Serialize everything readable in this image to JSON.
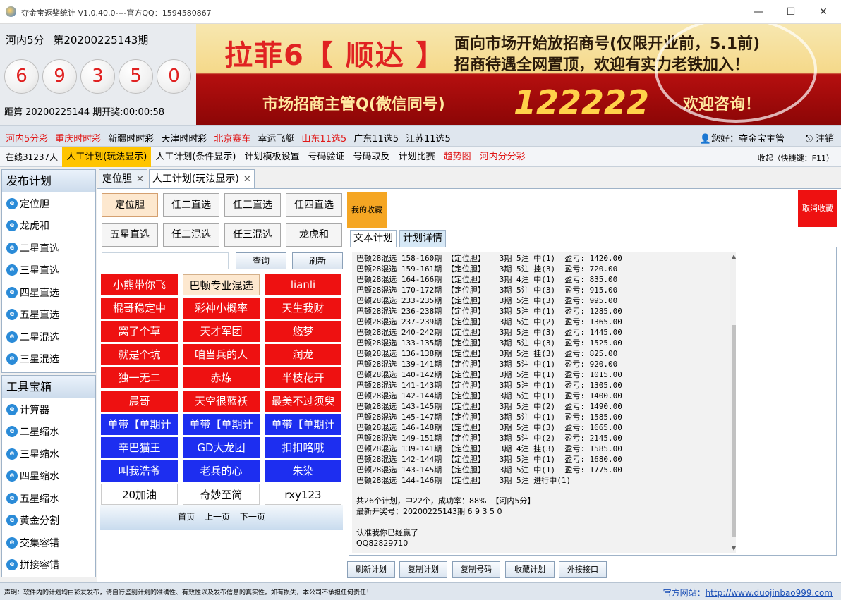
{
  "window": {
    "title": "夺金宝返奖统计 V1.0.40.0----官方QQ：1594580867",
    "minimize": "—",
    "maximize": "☐",
    "close": "✕"
  },
  "lottery": {
    "name": "河内5分",
    "period": "第20200225143期",
    "balls": [
      "6",
      "9",
      "3",
      "5",
      "0"
    ],
    "countdown": "距第 20200225144 期开奖:00:00:58"
  },
  "banner": {
    "line1": "拉菲6【 顺达 】",
    "line2": "面向市场开始放招商号(仅限开业前，5.1前)",
    "line3": "招商待遇全网置顶，欢迎有实力老铁加入！",
    "line4": "市场招商主管Q(微信同号)",
    "line5": "122222",
    "line6": "欢迎咨询！"
  },
  "typebar": {
    "items": [
      {
        "label": "河内5分彩",
        "red": true
      },
      {
        "label": "重庆时时彩",
        "red": true
      },
      {
        "label": "新疆时时彩",
        "red": false
      },
      {
        "label": "天津时时彩",
        "red": false
      },
      {
        "label": "北京赛车",
        "red": true
      },
      {
        "label": "幸运飞艇",
        "red": false
      },
      {
        "label": "山东11选5",
        "red": true
      },
      {
        "label": "广东11选5",
        "red": false
      },
      {
        "label": "江苏11选5",
        "red": false
      }
    ],
    "user": "您好：夺金宝主管",
    "logout": "注销"
  },
  "menubar": {
    "online": "在线31237人",
    "items": [
      {
        "label": "人工计划(玩法显示)",
        "active": true,
        "red": false
      },
      {
        "label": "人工计划(条件显示)",
        "active": false,
        "red": false
      },
      {
        "label": "计划模板设置",
        "active": false,
        "red": false
      },
      {
        "label": "号码验证",
        "active": false,
        "red": false
      },
      {
        "label": "号码取反",
        "active": false,
        "red": false
      },
      {
        "label": "计划比赛",
        "active": false,
        "red": false
      },
      {
        "label": "趋势图",
        "active": false,
        "red": true
      },
      {
        "label": "河内分分彩",
        "active": false,
        "red": true
      }
    ],
    "hint": "收起（快捷键：F11）"
  },
  "sidebar": {
    "publish_title": "发布计划",
    "publish_items": [
      "定位胆",
      "龙虎和",
      "二星直选",
      "三星直选",
      "四星直选",
      "五星直选",
      "二星混选",
      "三星混选"
    ],
    "tools_title": "工具宝箱",
    "tool_items": [
      "计算器",
      "二星缩水",
      "三星缩水",
      "四星缩水",
      "五星缩水",
      "黄金分割",
      "交集容错",
      "拼接容错"
    ]
  },
  "tabs": [
    {
      "label": "定位胆",
      "active": false
    },
    {
      "label": "人工计划(玩法显示)",
      "active": true
    }
  ],
  "play_buttons": [
    "定位胆",
    "任二直选",
    "任三直选",
    "任四直选",
    "五星直选",
    "任二混选",
    "任三混选",
    "龙虎和"
  ],
  "search": {
    "query_label": "查询",
    "refresh_label": "刷新",
    "value": ""
  },
  "planners": [
    {
      "label": "小熊带你飞",
      "color": "red"
    },
    {
      "label": "巴顿专业混选",
      "color": "cream"
    },
    {
      "label": "lianli",
      "color": "red"
    },
    {
      "label": "棍哥稳定中",
      "color": "red"
    },
    {
      "label": "彩神小概率",
      "color": "red"
    },
    {
      "label": "天生我财",
      "color": "red"
    },
    {
      "label": "窝了个草",
      "color": "red"
    },
    {
      "label": "天才军团",
      "color": "red"
    },
    {
      "label": "悠梦",
      "color": "red"
    },
    {
      "label": "就是个坑",
      "color": "red"
    },
    {
      "label": "咱当兵的人",
      "color": "red"
    },
    {
      "label": "润龙",
      "color": "red"
    },
    {
      "label": "独一无二",
      "color": "red"
    },
    {
      "label": "赤炼",
      "color": "red"
    },
    {
      "label": "半枝花开",
      "color": "red"
    },
    {
      "label": "晨哥",
      "color": "red"
    },
    {
      "label": "天空很蓝袄",
      "color": "red"
    },
    {
      "label": "最美不过须臾",
      "color": "red"
    },
    {
      "label": "单带【单期计",
      "color": "blue"
    },
    {
      "label": "单带【单期计",
      "color": "blue"
    },
    {
      "label": "单带【单期计",
      "color": "blue"
    },
    {
      "label": "辛巴猫王",
      "color": "blue"
    },
    {
      "label": "GD大龙团",
      "color": "blue"
    },
    {
      "label": "扣扣咯哦",
      "color": "blue"
    },
    {
      "label": "叫我浩爷",
      "color": "blue"
    },
    {
      "label": "老兵的心",
      "color": "blue"
    },
    {
      "label": "朱染",
      "color": "blue"
    },
    {
      "label": "20加油",
      "color": "white"
    },
    {
      "label": "奇妙至简",
      "color": "white"
    },
    {
      "label": "rxy123",
      "color": "white"
    }
  ],
  "pager": {
    "first": "首页",
    "prev": "上一页",
    "next": "下一页"
  },
  "favorite_label": "我的收藏",
  "cancel_favorite_label": "取消收藏",
  "subtabs": [
    {
      "label": "文本计划",
      "active": true
    },
    {
      "label": "计划详情",
      "active": false
    }
  ],
  "plan_lines": [
    "巴顿28混选 158-160期 【定位胆】   3期 5注 中(1)  盈亏: 1420.00",
    "巴顿28混选 159-161期 【定位胆】   3期 5注 挂(3)  盈亏: 720.00",
    "巴顿28混选 164-166期 【定位胆】   3期 4注 中(1)  盈亏: 835.00",
    "巴顿28混选 170-172期 【定位胆】   3期 5注 中(3)  盈亏: 915.00",
    "巴顿28混选 233-235期 【定位胆】   3期 5注 中(3)  盈亏: 995.00",
    "巴顿28混选 236-238期 【定位胆】   3期 5注 中(1)  盈亏: 1285.00",
    "巴顿28混选 237-239期 【定位胆】   3期 5注 中(2)  盈亏: 1365.00",
    "巴顿28混选 240-242期 【定位胆】   3期 5注 中(3)  盈亏: 1445.00",
    "巴顿28混选 133-135期 【定位胆】   3期 5注 中(3)  盈亏: 1525.00",
    "巴顿28混选 136-138期 【定位胆】   3期 5注 挂(3)  盈亏: 825.00",
    "巴顿28混选 139-141期 【定位胆】   3期 5注 中(1)  盈亏: 920.00",
    "巴顿28混选 140-142期 【定位胆】   3期 5注 中(1)  盈亏: 1015.00",
    "巴顿28混选 141-143期 【定位胆】   3期 5注 中(1)  盈亏: 1305.00",
    "巴顿28混选 142-144期 【定位胆】   3期 5注 中(1)  盈亏: 1400.00",
    "巴顿28混选 143-145期 【定位胆】   3期 5注 中(2)  盈亏: 1490.00",
    "巴顿28混选 145-147期 【定位胆】   3期 5注 中(1)  盈亏: 1585.00",
    "巴顿28混选 146-148期 【定位胆】   3期 5注 中(3)  盈亏: 1665.00",
    "巴顿28混选 149-151期 【定位胆】   3期 5注 中(2)  盈亏: 2145.00",
    "巴顿28混选 139-141期 【定位胆】   3期 4注 挂(3)  盈亏: 1585.00",
    "巴顿28混选 142-144期 【定位胆】   3期 5注 中(1)  盈亏: 1680.00",
    "巴顿28混选 143-145期 【定位胆】   3期 5注 中(1)  盈亏: 1775.00",
    "巴顿28混选 144-146期 【定位胆】   3期 5注 进行中(1)"
  ],
  "summary": {
    "stats": "共26个计划，中22个，成功率：88%  【河内5分】",
    "latest": "最新开奖号：20200225143期 6 9 3 5 0",
    "note": "认准我你已经赢了",
    "qq": "QQ82829710"
  },
  "bottom_buttons": [
    "刷新计划",
    "复制计划",
    "复制号码",
    "收藏计划",
    "外接接口"
  ],
  "footer": {
    "declaration": "声明：软件内的计划均由彩友发布，请自行鉴别计划的准确性、有效性以及发布信息的真实性。如有损失，本公司不承担任何责任！",
    "site_label": "官方网站：",
    "site_url": "http://www.duojinbao999.com"
  }
}
